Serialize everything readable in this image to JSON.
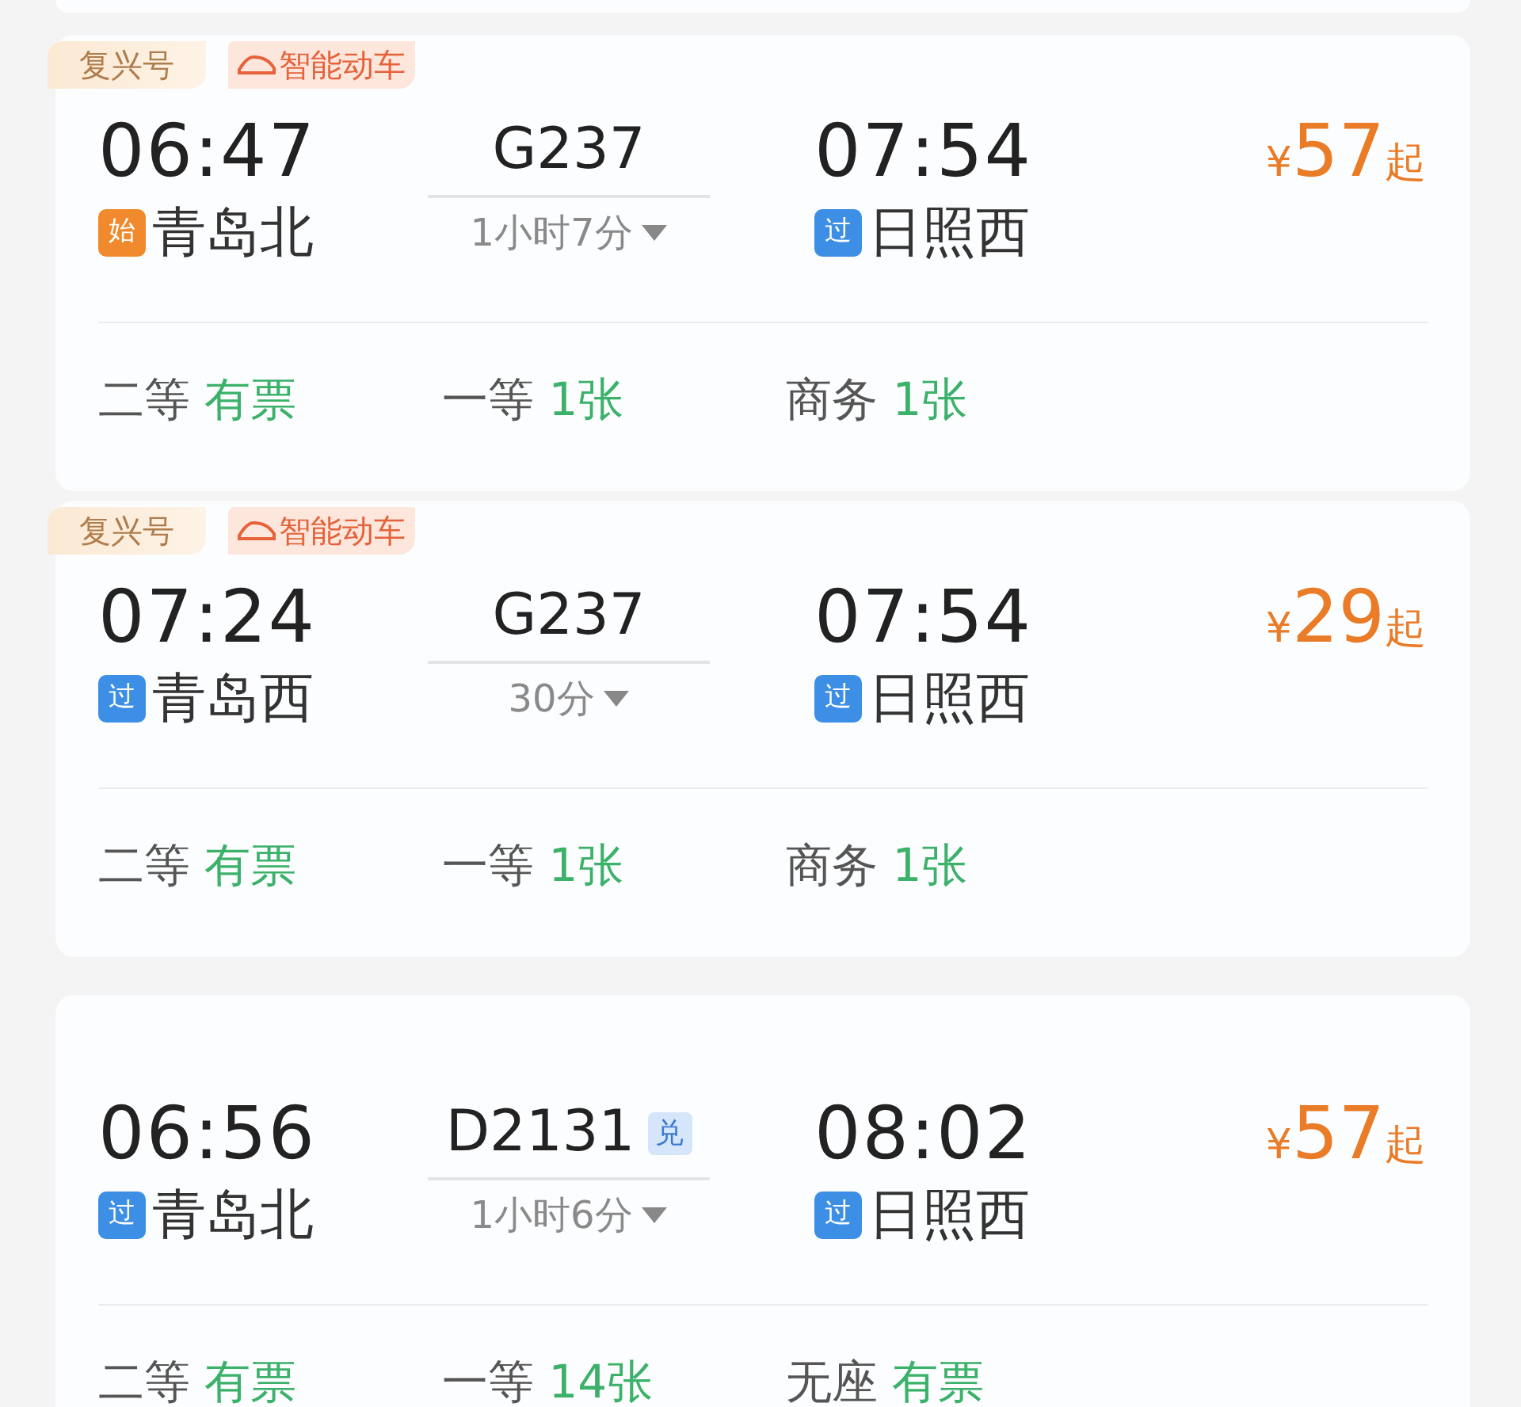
{
  "trains": [
    {
      "tags": [
        {
          "kind": "brand",
          "label": "复兴号"
        },
        {
          "kind": "smart",
          "label": "智能动车"
        }
      ],
      "depart": {
        "time": "06:47",
        "badge": {
          "kind": "start",
          "label": "始"
        },
        "station": "青岛北"
      },
      "train": {
        "number": "G237"
      },
      "duration": "1小时7分",
      "arrive": {
        "time": "07:54",
        "badge": {
          "kind": "pass",
          "label": "过"
        },
        "station": "日照西"
      },
      "price": {
        "symbol": "¥",
        "amount": "57",
        "suffix": "起"
      },
      "seats": [
        {
          "class": "二等",
          "availability": "有票"
        },
        {
          "class": "一等",
          "availability": "1张"
        },
        {
          "class": "商务",
          "availability": "1张"
        }
      ]
    },
    {
      "tags": [
        {
          "kind": "brand",
          "label": "复兴号"
        },
        {
          "kind": "smart",
          "label": "智能动车"
        }
      ],
      "depart": {
        "time": "07:24",
        "badge": {
          "kind": "pass",
          "label": "过"
        },
        "station": "青岛西"
      },
      "train": {
        "number": "G237"
      },
      "duration": "30分",
      "arrive": {
        "time": "07:54",
        "badge": {
          "kind": "pass",
          "label": "过"
        },
        "station": "日照西"
      },
      "price": {
        "symbol": "¥",
        "amount": "29",
        "suffix": "起"
      },
      "seats": [
        {
          "class": "二等",
          "availability": "有票"
        },
        {
          "class": "一等",
          "availability": "1张"
        },
        {
          "class": "商务",
          "availability": "1张"
        }
      ]
    },
    {
      "depart": {
        "time": "06:56",
        "badge": {
          "kind": "pass",
          "label": "过"
        },
        "station": "青岛北"
      },
      "train": {
        "number": "D2131",
        "badge": "兑"
      },
      "duration": "1小时6分",
      "arrive": {
        "time": "08:02",
        "badge": {
          "kind": "pass",
          "label": "过"
        },
        "station": "日照西"
      },
      "price": {
        "symbol": "¥",
        "amount": "57",
        "suffix": "起"
      },
      "seats": [
        {
          "class": "二等",
          "availability": "有票"
        },
        {
          "class": "一等",
          "availability": "14张"
        },
        {
          "class": "无座",
          "availability": "有票"
        }
      ]
    }
  ]
}
